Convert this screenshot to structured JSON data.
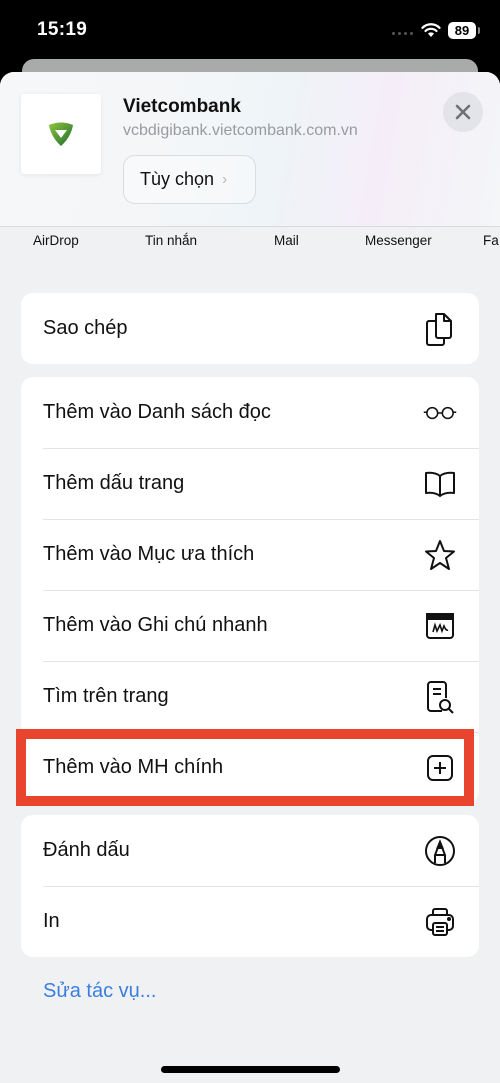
{
  "status_bar": {
    "time": "15:19",
    "battery": "89",
    "icons": [
      "cellular-signal-icon",
      "wifi-icon",
      "battery-icon"
    ]
  },
  "share_header": {
    "site_title": "Vietcombank",
    "site_url": "vcbdigibank.vietcombank.com.vn",
    "options_label": "Tùy chọn",
    "close_icon": "close-icon",
    "logo_icon": "vietcombank-logo-icon",
    "logo_color": "#3b8a2e"
  },
  "share_targets": [
    {
      "label": "AirDrop"
    },
    {
      "label": "Tin nhắn"
    },
    {
      "label": "Mail"
    },
    {
      "label": "Messenger"
    },
    {
      "label": "Fa"
    }
  ],
  "actions": {
    "group1": [
      {
        "label": "Sao chép",
        "icon": "copy-icon"
      }
    ],
    "group2": [
      {
        "label": "Thêm vào Danh sách đọc",
        "icon": "glasses-icon"
      },
      {
        "label": "Thêm dấu trang",
        "icon": "book-icon"
      },
      {
        "label": "Thêm vào Mục ưa thích",
        "icon": "star-icon"
      },
      {
        "label": "Thêm vào Ghi chú nhanh",
        "icon": "quick-note-icon"
      },
      {
        "label": "Tìm trên trang",
        "icon": "find-on-page-icon"
      },
      {
        "label": "Thêm vào MH chính",
        "icon": "add-square-icon",
        "highlighted": true
      }
    ],
    "group3": [
      {
        "label": "Đánh dấu",
        "icon": "markup-icon"
      },
      {
        "label": "In",
        "icon": "printer-icon"
      }
    ]
  },
  "edit_actions_label": "Sửa tác vụ...",
  "colors": {
    "highlight": "#e8442e",
    "link": "#3a7fe0",
    "sheet_bg": "#f0f1f3"
  }
}
